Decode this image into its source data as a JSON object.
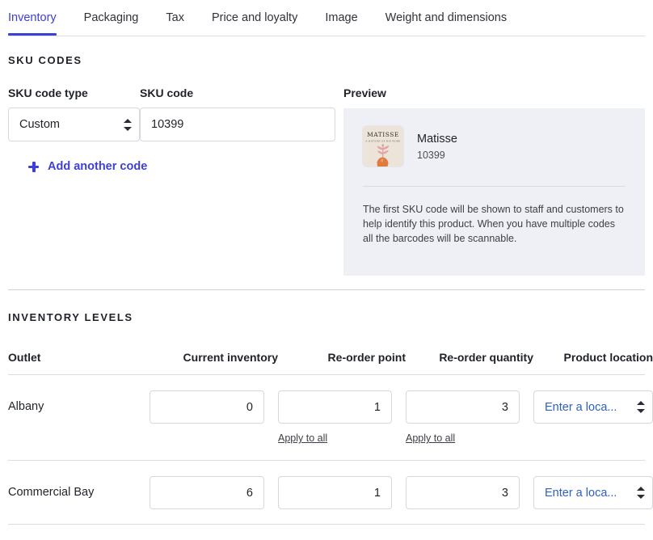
{
  "tabs": [
    {
      "label": "Inventory",
      "active": true
    },
    {
      "label": "Packaging",
      "active": false
    },
    {
      "label": "Tax",
      "active": false
    },
    {
      "label": "Price and loyalty",
      "active": false
    },
    {
      "label": "Image",
      "active": false
    },
    {
      "label": "Weight and dimensions",
      "active": false
    }
  ],
  "sku_section": {
    "heading": "SKU CODES",
    "type_label": "SKU code type",
    "code_label": "SKU code",
    "type_value": "Custom",
    "code_value": "10399",
    "code_placeholder": "",
    "add_another_label": "Add another code"
  },
  "preview": {
    "title": "Preview",
    "product_name": "Matisse",
    "product_sku": "10399",
    "thumbnail_title": "MATISSE",
    "thumbnail_subtitle": "A HISTORY OF HIS WORK",
    "note": "The first SKU code will be shown to staff and customers to help identify this product. When you have multiple codes all the barcodes will be scannable."
  },
  "inventory": {
    "heading": "INVENTORY LEVELS",
    "columns": [
      "Outlet",
      "Current inventory",
      "Re-order point",
      "Re-order quantity",
      "Product location"
    ],
    "apply_to_all_label": "Apply to all",
    "location_placeholder": "Enter a loca...",
    "rows": [
      {
        "outlet": "Albany",
        "current_inventory": "0",
        "reorder_point": "1",
        "reorder_quantity": "3",
        "product_location": "",
        "show_apply_links": true
      },
      {
        "outlet": "Commercial Bay",
        "current_inventory": "6",
        "reorder_point": "1",
        "reorder_quantity": "3",
        "product_location": "",
        "show_apply_links": false
      }
    ]
  },
  "colors": {
    "accent": "#3d40d6",
    "link": "#2f5fbf",
    "panel_bg": "#eff0f5",
    "border": "#d6d8de",
    "text": "#1f2229"
  }
}
